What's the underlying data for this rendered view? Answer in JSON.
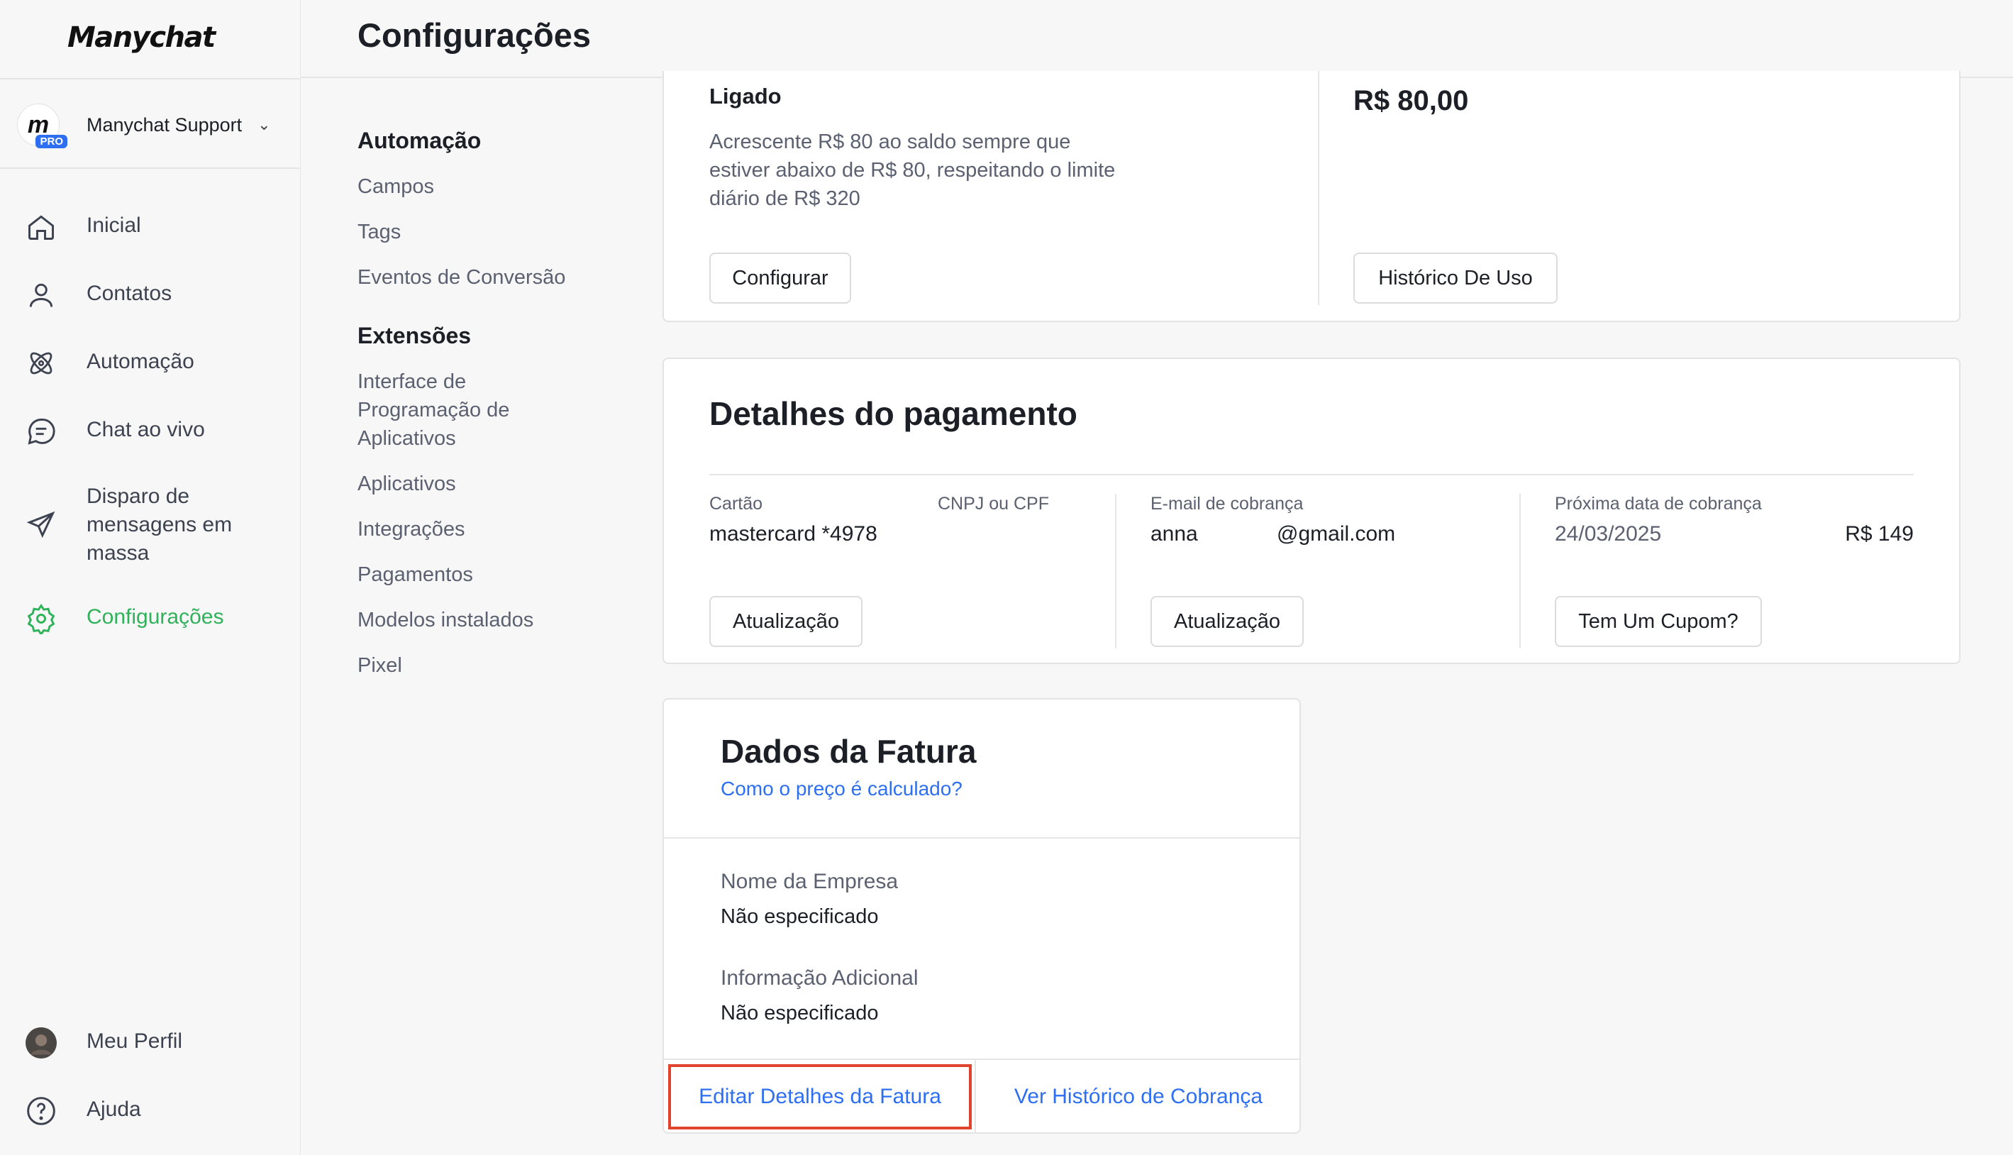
{
  "app": {
    "logo": "Manychat",
    "account_name": "Manychat Support",
    "account_badge": "PRO",
    "account_logo_letter": "m"
  },
  "nav": {
    "home": "Inicial",
    "contacts": "Contatos",
    "automation": "Automação",
    "live_chat": "Chat ao vivo",
    "broadcast": "Disparo de mensagens em massa",
    "settings": "Configurações",
    "profile": "Meu Perfil",
    "help": "Ajuda"
  },
  "header": {
    "title": "Configurações"
  },
  "settings_nav": {
    "group1_title": "Automação",
    "fields": "Campos",
    "tags": "Tags",
    "conversion_events": "Eventos de Conversão",
    "group2_title": "Extensões",
    "api": "Interface de Programação de Aplicativos",
    "apps": "Aplicativos",
    "integrations": "Integrações",
    "payments": "Pagamentos",
    "installed_templates": "Modelos instalados",
    "pixel": "Pixel"
  },
  "auto_recharge": {
    "status": "Ligado",
    "description": "Acrescente R$ 80 ao saldo sempre que estiver abaixo de R$ 80, respeitando o limite diário de R$ 320",
    "configure_label": "Configurar",
    "amount": "R$ 80,00",
    "usage_history_label": "Histórico De Uso"
  },
  "payment_details": {
    "title": "Detalhes do pagamento",
    "card_label": "Cartão",
    "card_value": "mastercard *4978",
    "tax_label": "CNPJ ou CPF",
    "email_label": "E-mail de cobrança",
    "email_user": "anna",
    "email_domain": "@gmail.com",
    "next_billing_label": "Próxima data de cobrança",
    "next_billing_date": "24/03/2025",
    "next_billing_amount": "R$ 149",
    "update_label": "Atualização",
    "update_label_2": "Atualização",
    "coupon_label": "Tem Um Cupom?"
  },
  "invoice": {
    "title": "Dados da Fatura",
    "pricing_link": "Como o preço é calculado?",
    "company_label": "Nome da Empresa",
    "company_value": "Não especificado",
    "extra_label": "Informação Adicional",
    "extra_value": "Não especificado",
    "edit_label": "Editar Detalhes da Fatura",
    "history_label": "Ver Histórico de Cobrança"
  },
  "colors": {
    "accent_green": "#2fb25a",
    "link_blue": "#2d6ff0",
    "highlight_red": "#e0442c"
  }
}
